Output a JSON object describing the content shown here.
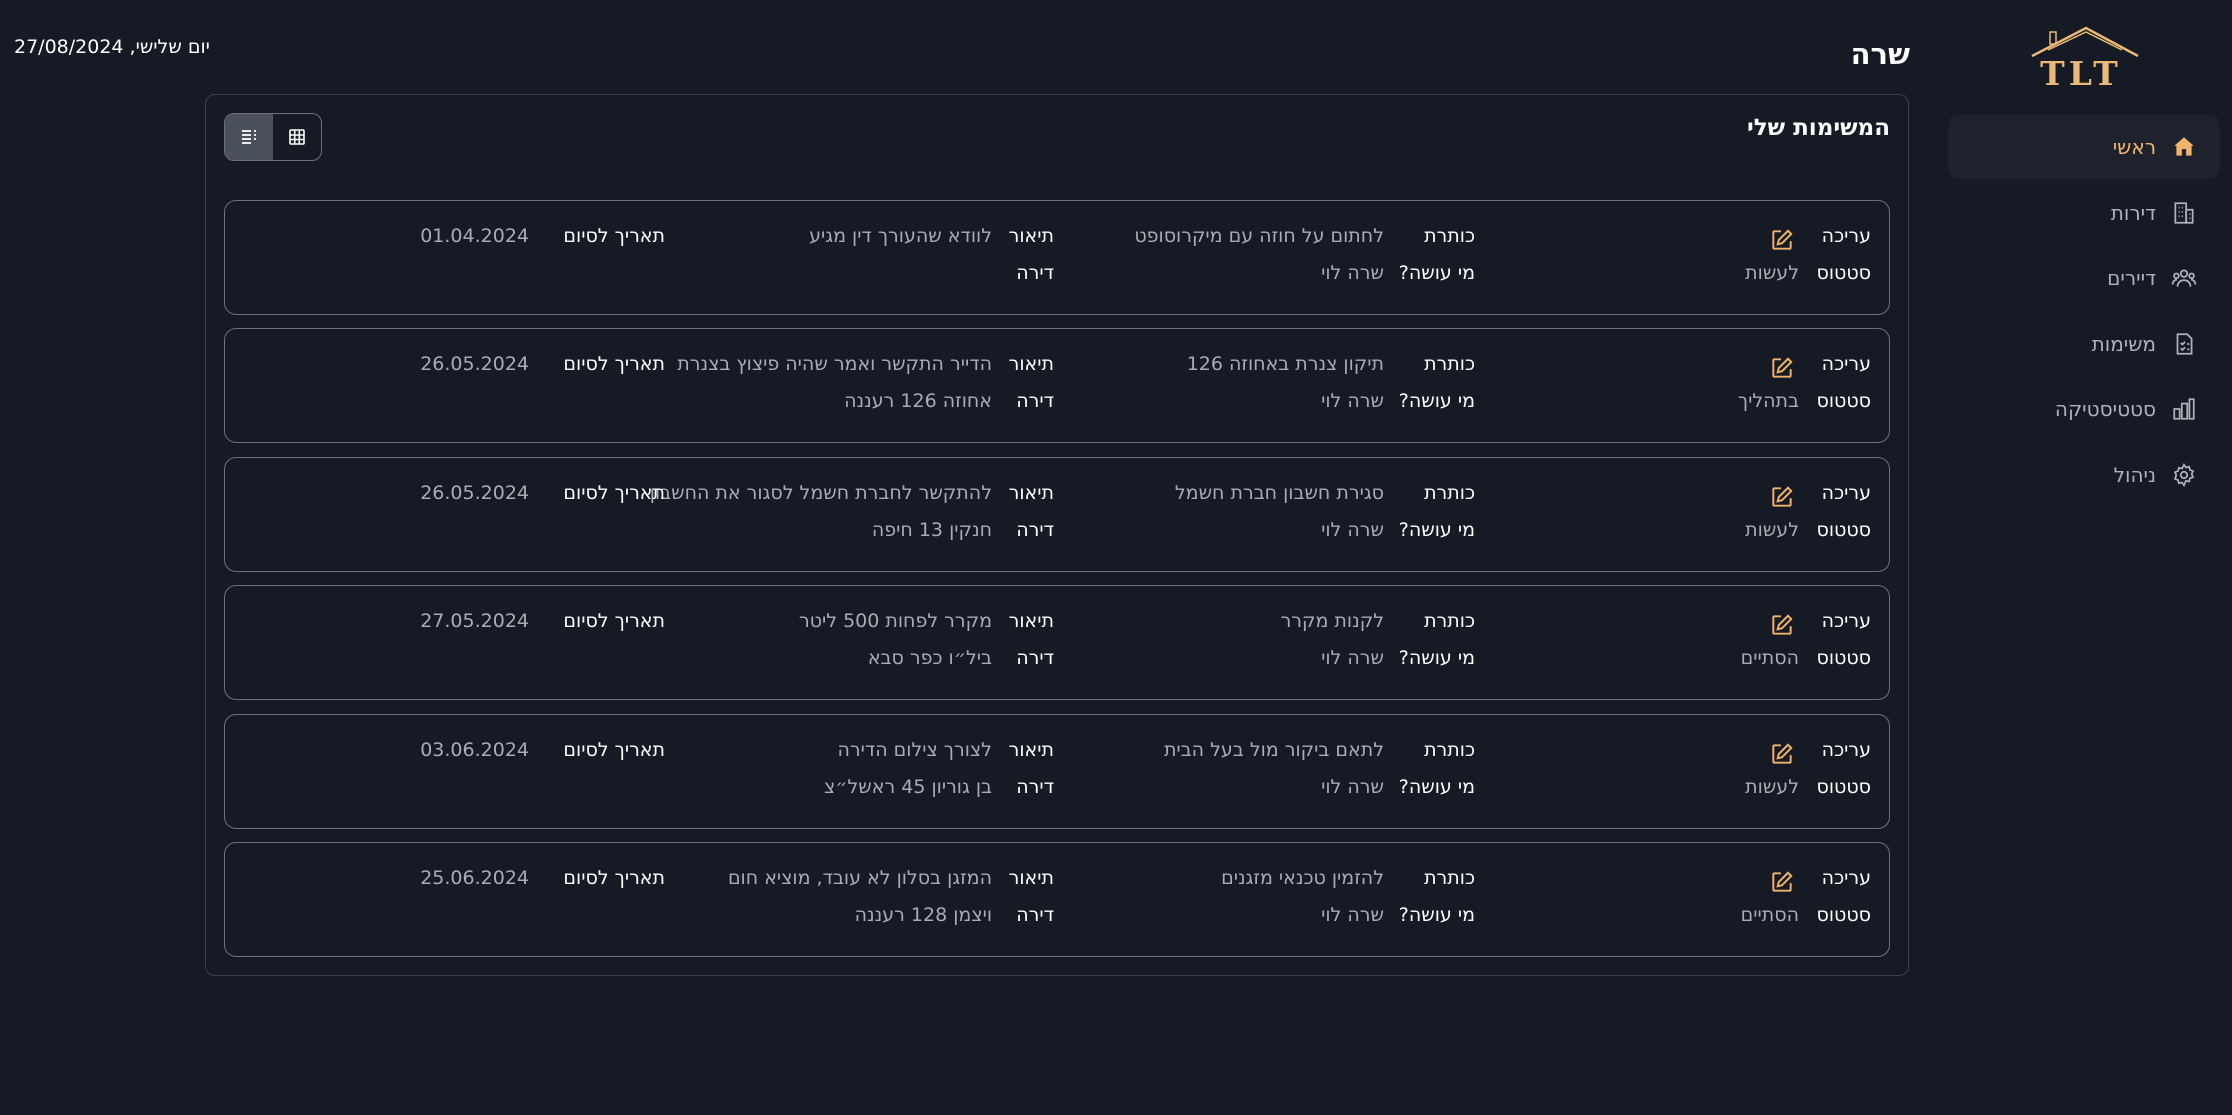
{
  "header": {
    "date": "יום שלישי, 27/08/2024",
    "title": "שרה"
  },
  "logo": {
    "text": "TLT"
  },
  "sidebar": {
    "items": [
      {
        "label": "ראשי",
        "icon": "home-icon",
        "active": true
      },
      {
        "label": "דירות",
        "icon": "building-icon",
        "active": false
      },
      {
        "label": "דיירים",
        "icon": "users-icon",
        "active": false
      },
      {
        "label": "משימות",
        "icon": "tasks-icon",
        "active": false
      },
      {
        "label": "סטטיסטיקה",
        "icon": "chart-icon",
        "active": false
      },
      {
        "label": "ניהול",
        "icon": "gear-icon",
        "active": false
      }
    ]
  },
  "panel": {
    "title": "המשימות שלי"
  },
  "labels": {
    "edit": "עריכה",
    "status": "סטטוס",
    "title": "כותרת",
    "who": "מי עושה?",
    "description": "תיאור",
    "apartment": "דירה",
    "end_date": "תאריך לסיום"
  },
  "tasks": [
    {
      "status": "לעשות",
      "title": "לחתום על חוזה עם מיקרוסופט",
      "who": "שרה לוי",
      "description": "לוודא שהעורך דין מגיע",
      "apartment": "",
      "end_date": "01.04.2024"
    },
    {
      "status": "בתהליך",
      "title": "תיקון צנרת באחוזה 126",
      "who": "שרה לוי",
      "description": "הדייר התקשר ואמר שהיה פיצוץ בצנרת",
      "apartment": "אחוזה 126 רעננה",
      "end_date": "26.05.2024"
    },
    {
      "status": "לעשות",
      "title": "סגירת חשבון חברת חשמל",
      "who": "שרה לוי",
      "description": "להתקשר לחברת חשמל לסגור את החשבון",
      "apartment": "חנקין 13 חיפה",
      "end_date": "26.05.2024"
    },
    {
      "status": "הסתיים",
      "title": "לקנות מקרר",
      "who": "שרה לוי",
      "description": "מקרר לפחות 500 ליטר",
      "apartment": "ביל״ו כפר סבא",
      "end_date": "27.05.2024"
    },
    {
      "status": "לעשות",
      "title": "לתאם ביקור מול בעל הבית",
      "who": "שרה לוי",
      "description": "לצורך צילום הדירה",
      "apartment": "בן גוריון 45 ראשל״צ",
      "end_date": "03.06.2024"
    },
    {
      "status": "הסתיים",
      "title": "להזמין טכנאי מזגנים",
      "who": "שרה לוי",
      "description": "המזגן בסלון לא עובד, מוציא חום",
      "apartment": "ויצמן 128 רעננה",
      "end_date": "25.06.2024"
    }
  ],
  "colors": {
    "background": "#161a25",
    "accent": "#f0b56a",
    "muted_text": "#a8acb5",
    "border": "#6b707b"
  }
}
